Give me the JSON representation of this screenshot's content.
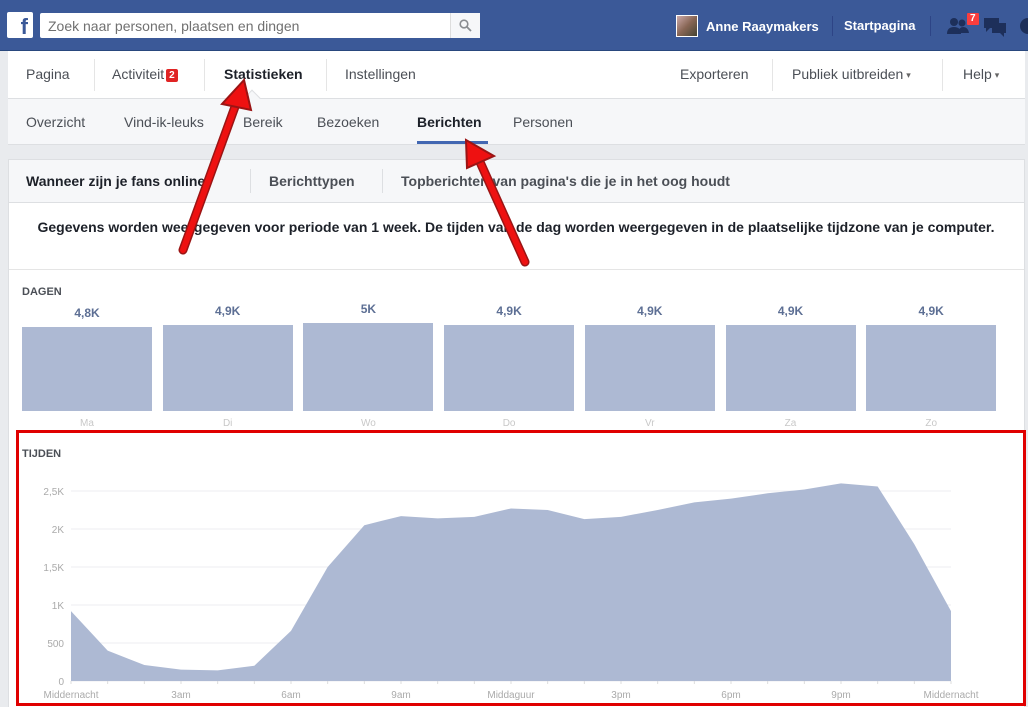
{
  "topbar": {
    "logo": "f",
    "search_placeholder": "Zoek naar personen, plaatsen en dingen",
    "user_name": "Anne Raaymakers",
    "home_label": "Startpagina",
    "friend_requests_count": "7",
    "icons": [
      "search-icon",
      "friends-icon",
      "messages-icon",
      "globe-icon"
    ]
  },
  "page_nav": {
    "items": [
      "Pagina",
      "Activiteit",
      "Statistieken",
      "Instellingen"
    ],
    "activity_badge": "2",
    "right_items": [
      "Exporteren",
      "Publiek uitbreiden",
      "Help"
    ]
  },
  "sub_nav": {
    "items": [
      "Overzicht",
      "Vind-ik-leuks",
      "Bereik",
      "Bezoeken",
      "Berichten",
      "Personen"
    ],
    "active": "Berichten"
  },
  "posts_tabs": [
    "Wanneer zijn je fans online?",
    "Berichttypen",
    "Topberichten van pagina's die je in het oog houdt"
  ],
  "info_text": "Gegevens worden weergegeven voor periode van 1 week. De tijden van de dag worden weergegeven in de plaatselijke tijdzone van je computer.",
  "chart_data": [
    {
      "type": "bar",
      "title": "DAGEN",
      "categories": [
        "Ma",
        "Di",
        "Wo",
        "Do",
        "Vr",
        "Za",
        "Zo"
      ],
      "value_labels": [
        "4,8K",
        "4,9K",
        "5K",
        "4,9K",
        "4,9K",
        "4,9K",
        "4,9K"
      ],
      "values": [
        4800,
        4900,
        5000,
        4900,
        4900,
        4900,
        4900
      ],
      "color": "#adb9d3"
    },
    {
      "type": "area",
      "title": "TIJDEN",
      "ylim": [
        0,
        2800
      ],
      "yticks": [
        0,
        500,
        1000,
        1500,
        2000,
        2500
      ],
      "ytick_labels": [
        "0",
        "500",
        "1K",
        "1,5K",
        "2K",
        "2,5K"
      ],
      "x": [
        0,
        1,
        2,
        3,
        4,
        5,
        6,
        7,
        8,
        9,
        10,
        11,
        12,
        13,
        14,
        15,
        16,
        17,
        18,
        19,
        20,
        21,
        22,
        23,
        24
      ],
      "xtick_labels": [
        {
          "x": 0,
          "label": "Middernacht"
        },
        {
          "x": 3,
          "label": "3am"
        },
        {
          "x": 6,
          "label": "6am"
        },
        {
          "x": 9,
          "label": "9am"
        },
        {
          "x": 12,
          "label": "Middaguur"
        },
        {
          "x": 15,
          "label": "3pm"
        },
        {
          "x": 18,
          "label": "6pm"
        },
        {
          "x": 21,
          "label": "9pm"
        },
        {
          "x": 24,
          "label": "Middernacht"
        }
      ],
      "values": [
        920,
        400,
        210,
        150,
        140,
        200,
        660,
        1500,
        2050,
        2170,
        2140,
        2160,
        2270,
        2250,
        2130,
        2160,
        2250,
        2350,
        2400,
        2470,
        2520,
        2600,
        2560,
        1800,
        920
      ],
      "color": "#adb9d3",
      "grid": true
    }
  ],
  "colors": {
    "brand": "#3b5998",
    "bar": "#adb9d3",
    "annotation_red": "#e00000"
  }
}
